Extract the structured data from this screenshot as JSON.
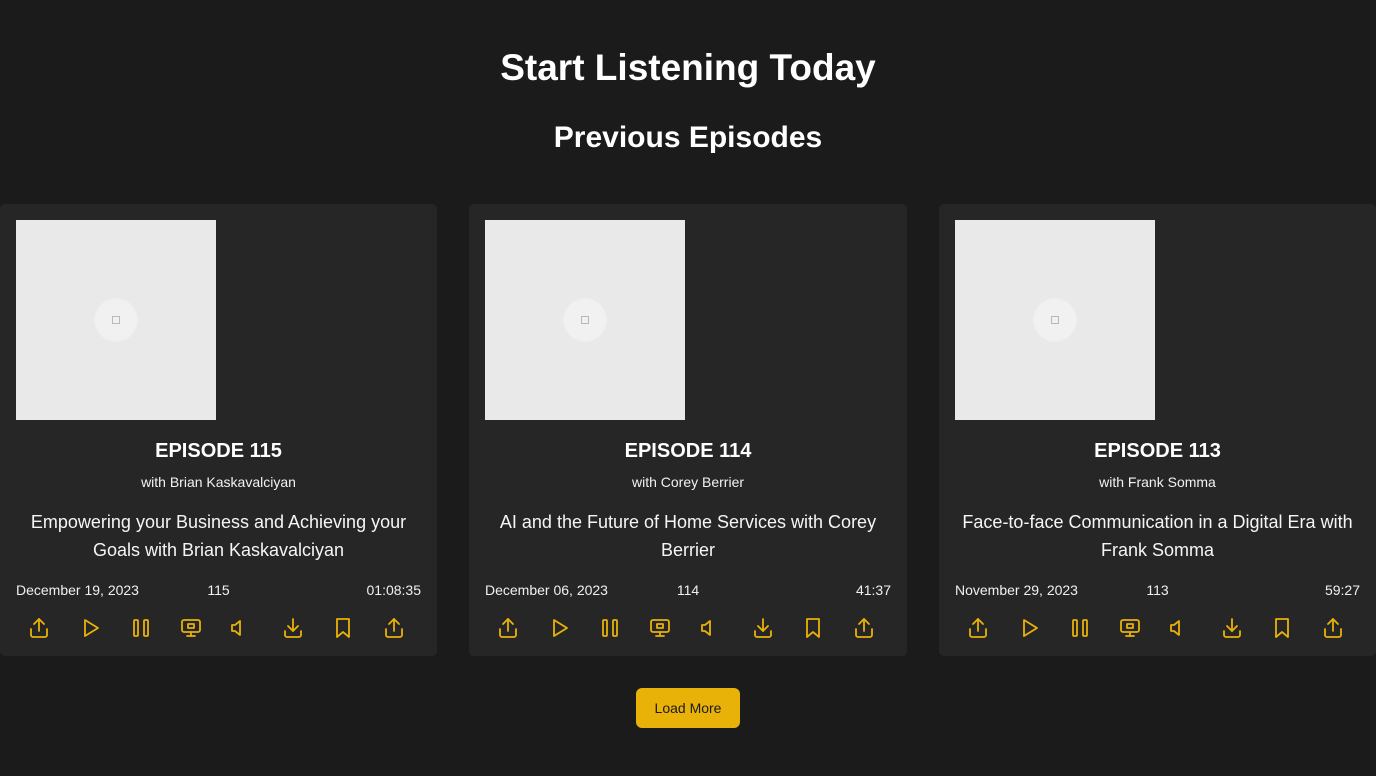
{
  "header": {
    "title": "Start Listening Today",
    "subtitle": "Previous Episodes"
  },
  "colors": {
    "background": "#1b1b1b",
    "card": "#262626",
    "accent": "#e8b208",
    "text": "#ffffff"
  },
  "episodes": [
    {
      "title": "EPISODE 115",
      "guest": "with Brian Kaskavalciyan",
      "description": "Empowering your Business and Achieving your Goals with Brian Kaskavalciyan",
      "date": "December 19, 2023",
      "number": "115",
      "duration": "01:08:35"
    },
    {
      "title": "EPISODE 114",
      "guest": "with Corey Berrier",
      "description": "AI and the Future of Home Services with Corey Berrier",
      "date": "December 06, 2023",
      "number": "114",
      "duration": "41:37"
    },
    {
      "title": "EPISODE 113",
      "guest": "with Frank Somma",
      "description": "Face-to-face Communication in a Digital Era with Frank Somma",
      "date": "November 29, 2023",
      "number": "113",
      "duration": "59:27"
    }
  ],
  "controls": [
    "share-icon",
    "play-icon",
    "pause-icon",
    "screen-icon",
    "volume-icon",
    "download-icon",
    "bookmark-icon",
    "share-icon"
  ],
  "load_more_label": "Load More"
}
